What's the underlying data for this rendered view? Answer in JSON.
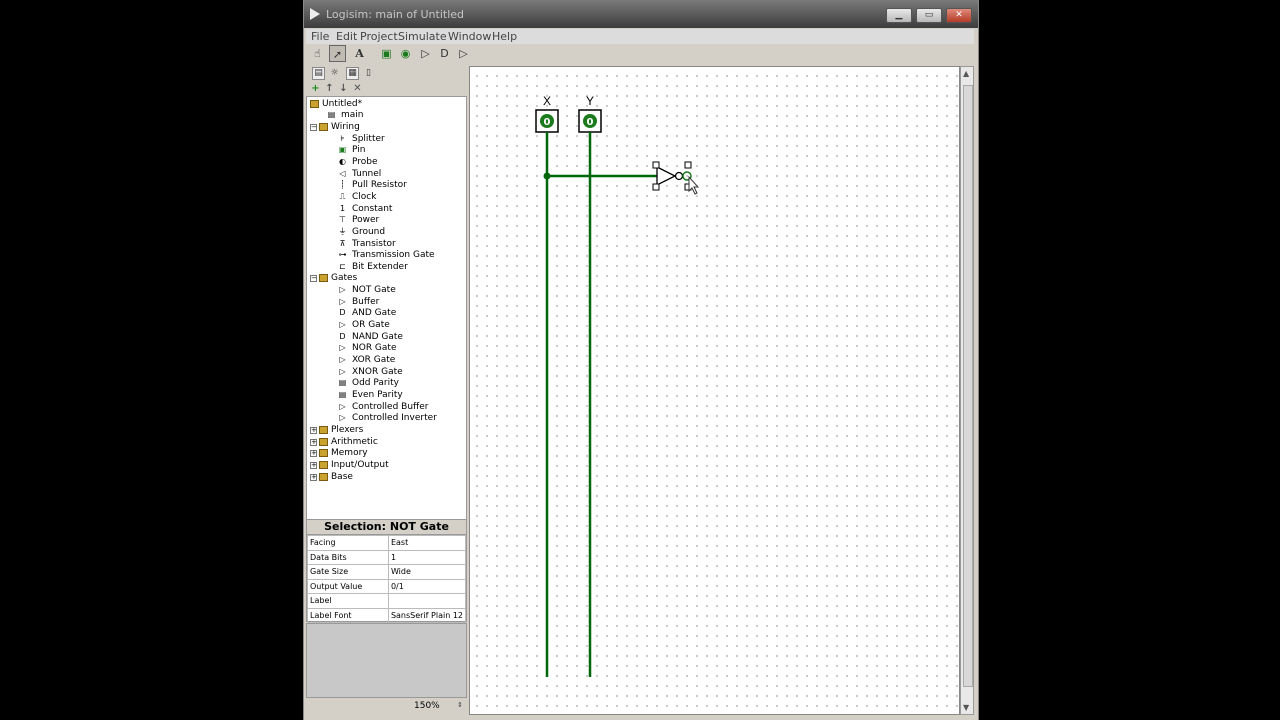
{
  "window": {
    "title": "Logisim: main of Untitled"
  },
  "menu": [
    "File",
    "Edit",
    "Project",
    "Simulate",
    "Window",
    "Help"
  ],
  "tree": {
    "project": "Untitled*",
    "circuit": "main",
    "libraries": [
      {
        "name": "Wiring",
        "expanded": true,
        "items": [
          "Splitter",
          "Pin",
          "Probe",
          "Tunnel",
          "Pull Resistor",
          "Clock",
          "Constant",
          "Power",
          "Ground",
          "Transistor",
          "Transmission Gate",
          "Bit Extender"
        ]
      },
      {
        "name": "Gates",
        "expanded": true,
        "items": [
          "NOT Gate",
          "Buffer",
          "AND Gate",
          "OR Gate",
          "NAND Gate",
          "NOR Gate",
          "XOR Gate",
          "XNOR Gate",
          "Odd Parity",
          "Even Parity",
          "Controlled Buffer",
          "Controlled Inverter"
        ]
      },
      {
        "name": "Plexers",
        "expanded": false,
        "items": []
      },
      {
        "name": "Arithmetic",
        "expanded": false,
        "items": []
      },
      {
        "name": "Memory",
        "expanded": false,
        "items": []
      },
      {
        "name": "Input/Output",
        "expanded": false,
        "items": []
      },
      {
        "name": "Base",
        "expanded": false,
        "items": []
      }
    ]
  },
  "selection": {
    "title": "Selection: NOT Gate",
    "attributes": [
      {
        "key": "Facing",
        "value": "East"
      },
      {
        "key": "Data Bits",
        "value": "1"
      },
      {
        "key": "Gate Size",
        "value": "Wide"
      },
      {
        "key": "Output Value",
        "value": "0/1"
      },
      {
        "key": "Label",
        "value": ""
      },
      {
        "key": "Label Font",
        "value": "SansSerif Plain 12"
      }
    ]
  },
  "zoom": "150%",
  "canvas": {
    "pins": [
      {
        "label": "X",
        "value": "0"
      },
      {
        "label": "Y",
        "value": "0"
      }
    ]
  },
  "colors": {
    "wire": "#00660a",
    "pin_value": "#1b7a1b"
  }
}
